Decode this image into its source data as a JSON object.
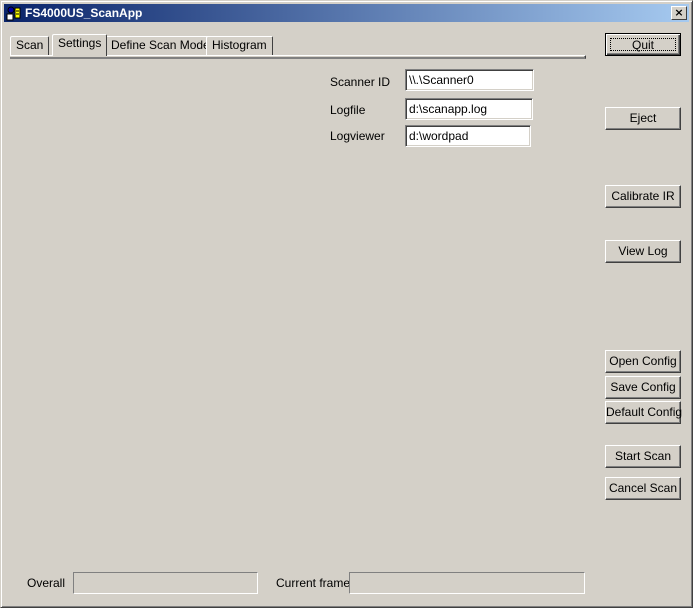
{
  "window": {
    "title": "FS4000US_ScanApp",
    "close_glyph": "×"
  },
  "tabs": [
    {
      "label": "Scan",
      "active": false
    },
    {
      "label": "Settings",
      "active": true
    },
    {
      "label": "Define Scan Mode",
      "active": false
    },
    {
      "label": "Histogram",
      "active": false
    }
  ],
  "settings": {
    "scanner_id": {
      "label": "Scanner ID",
      "value": "\\\\.\\Scanner0"
    },
    "logfile": {
      "label": "Logfile",
      "value": "d:\\scanapp.log"
    },
    "logviewer": {
      "label": "Logviewer",
      "value": "d:\\wordpad"
    }
  },
  "buttons": {
    "quit": "Quit",
    "eject": "Eject",
    "calibrate_ir": "Calibrate IR",
    "view_log": "View Log",
    "open_config": "Open Config",
    "save_config": "Save Config",
    "default_config": "Default Config",
    "start_scan": "Start Scan",
    "cancel_scan": "Cancel Scan"
  },
  "status": {
    "overall_label": "Overall",
    "overall_progress": 0,
    "current_frame_label": "Current frame",
    "current_frame_progress": 0
  },
  "colors": {
    "window_bg": "#d4d0c8",
    "titlebar_start": "#0a246a",
    "titlebar_end": "#a6caf0"
  }
}
